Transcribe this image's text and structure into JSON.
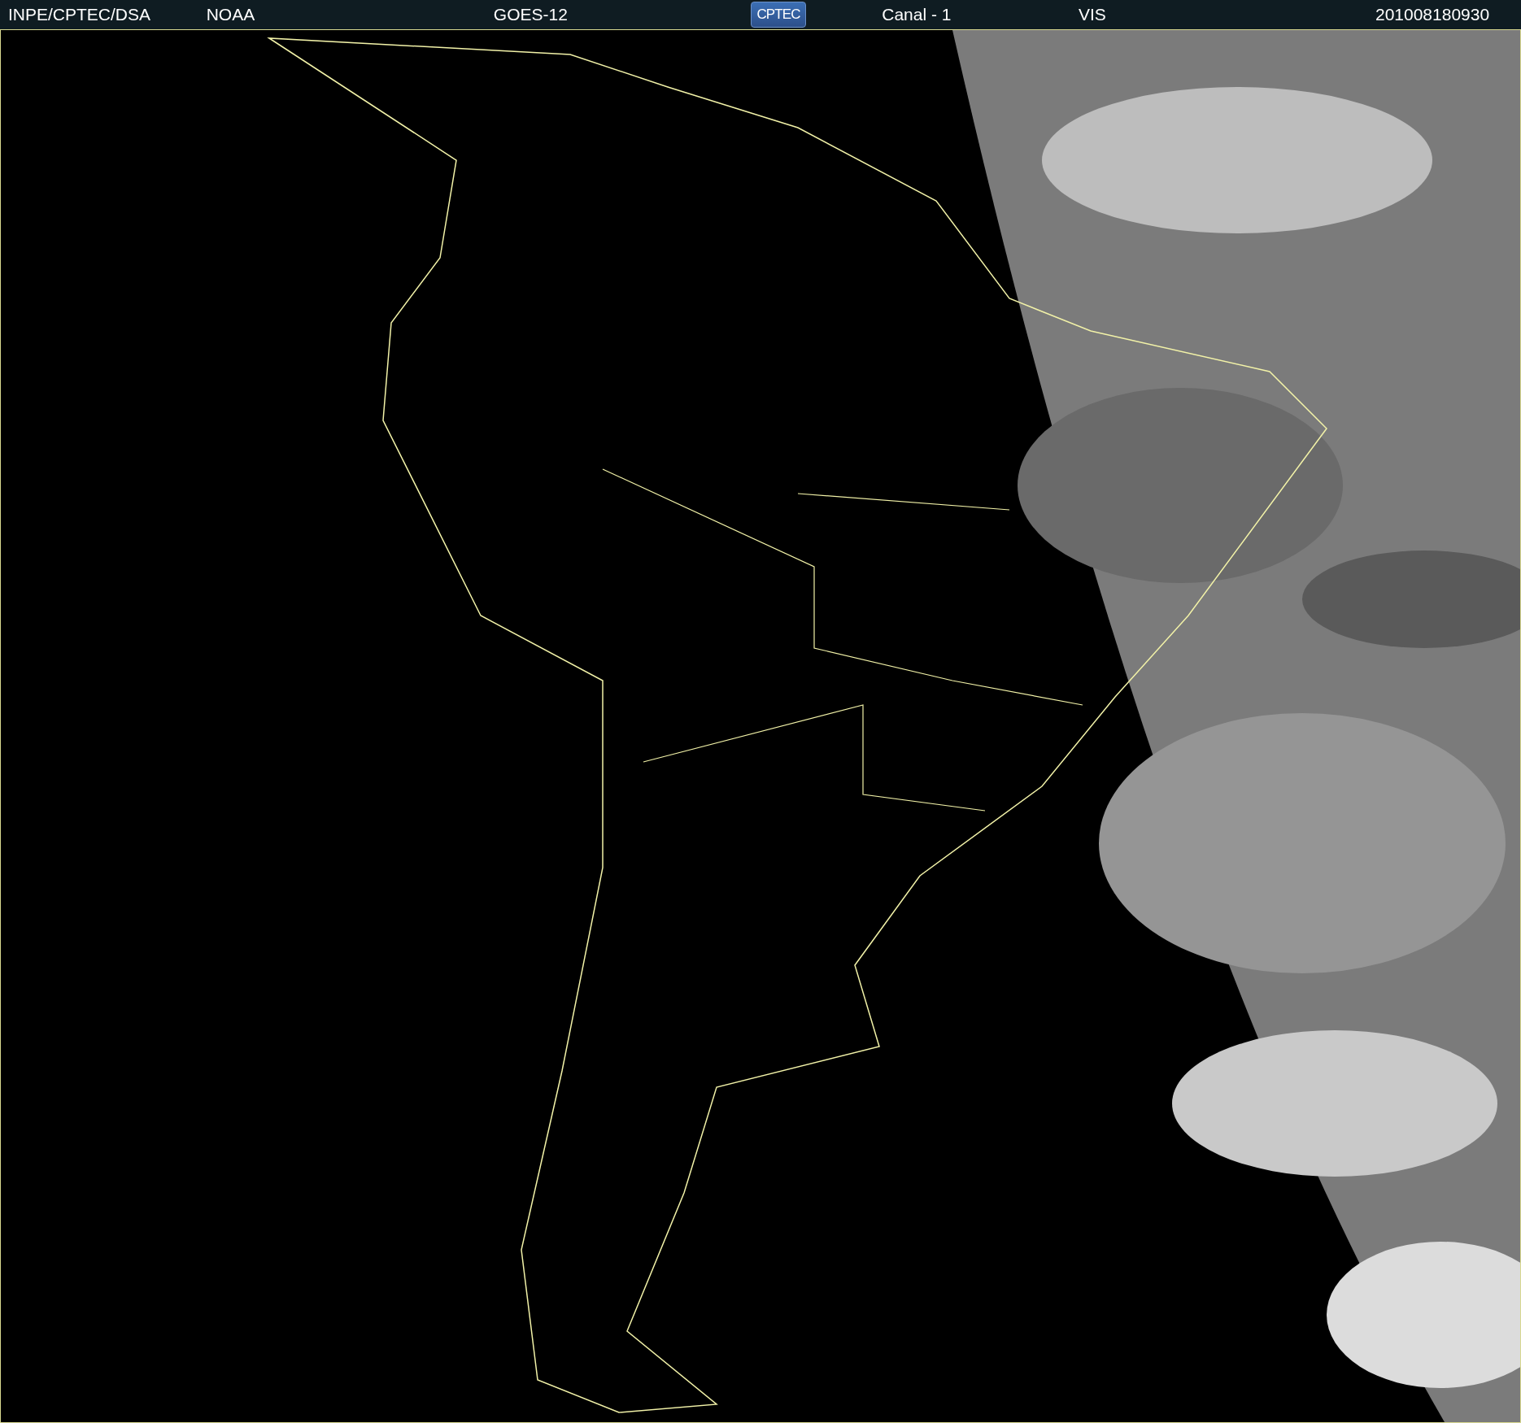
{
  "header": {
    "items": [
      {
        "kind": "text",
        "text": "INPE/CPTEC/DSA"
      },
      {
        "kind": "text",
        "text": "NOAA"
      },
      {
        "kind": "text",
        "text": "GOES-12"
      },
      {
        "kind": "logo",
        "text": "CPTEC"
      },
      {
        "kind": "text",
        "text": "Canal - 1"
      },
      {
        "kind": "text",
        "text": "VIS"
      },
      {
        "kind": "text",
        "text": "201008180930"
      }
    ]
  }
}
